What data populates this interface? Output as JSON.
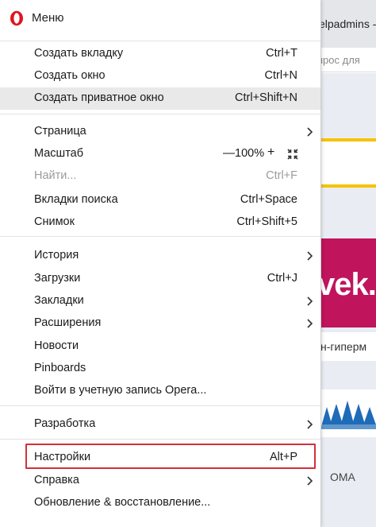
{
  "background": {
    "tab_text": "elpadmins -",
    "search_placeholder": "прос для",
    "banner_text": "vek.b",
    "text2": "н-гиперм",
    "footer_text": "OMA",
    "colors": {
      "banner": "#c0145d",
      "accent_yellow": "#f5c300"
    }
  },
  "menu": {
    "title": "Меню",
    "logo": "opera-logo",
    "items": {
      "new_tab": {
        "label": "Создать вкладку",
        "shortcut": "Ctrl+T"
      },
      "new_window": {
        "label": "Создать окно",
        "shortcut": "Ctrl+N"
      },
      "new_private_window": {
        "label": "Создать приватное окно",
        "shortcut": "Ctrl+Shift+N"
      },
      "page": {
        "label": "Страница"
      },
      "zoom": {
        "label": "Масштаб",
        "minus": "—",
        "value": "100%",
        "plus": "+",
        "fullscreen_icon": "fullscreen-icon"
      },
      "find": {
        "label": "Найти...",
        "shortcut": "Ctrl+F"
      },
      "search_tabs": {
        "label": "Вкладки поиска",
        "shortcut": "Ctrl+Space"
      },
      "snapshot": {
        "label": "Снимок",
        "shortcut": "Ctrl+Shift+5"
      },
      "history": {
        "label": "История"
      },
      "downloads": {
        "label": "Загрузки",
        "shortcut": "Ctrl+J"
      },
      "bookmarks": {
        "label": "Закладки"
      },
      "extensions": {
        "label": "Расширения"
      },
      "news": {
        "label": "Новости"
      },
      "pinboards": {
        "label": "Pinboards"
      },
      "sign_in": {
        "label": "Войти в учетную запись Opera..."
      },
      "developer": {
        "label": "Разработка"
      },
      "settings": {
        "label": "Настройки",
        "shortcut": "Alt+P"
      },
      "help": {
        "label": "Справка"
      },
      "update": {
        "label": "Обновление & восстановление..."
      }
    },
    "highlight_color": "#d3303b"
  }
}
